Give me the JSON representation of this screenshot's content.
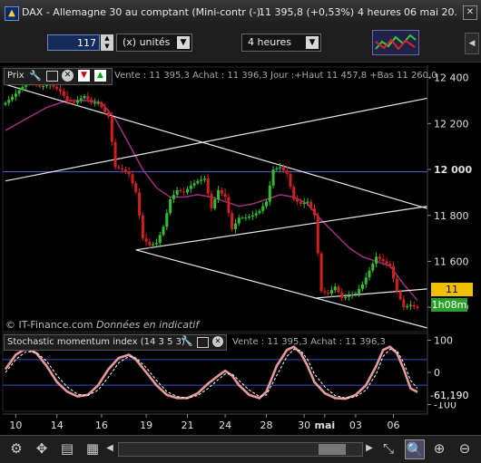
{
  "window": {
    "title": "DAX - Allemagne 30 au comptant (Mini-contr (-)",
    "last": "11 395,8 (+0,53%)",
    "period": "4 heures",
    "date": "06 mai 20..."
  },
  "toolbar": {
    "quantity": "117",
    "unit_label": "(x) unités",
    "timeframe": "4 heures"
  },
  "price_panel": {
    "label": "Prix",
    "info": "Vente : 11 395,3 Achat : 11 396,3 Jour :+Haut 11 457,8 +Bas 11 260,0",
    "watermark_brand": "© IT-Finance.com",
    "watermark_note": "Données en indicatif",
    "last_price_badge": "11 395,8",
    "time_left_badge": "1h08m"
  },
  "stoch_panel": {
    "label": "Stochastic momentum index (14 3 5 3)",
    "info": "Vente : 11 395,3 Achat : 11 396,3",
    "value_badge": "-61,190"
  },
  "colors": {
    "up": "#2fbf2f",
    "down": "#d12020",
    "ma": "#a0307f",
    "trendline": "#e8e8e8",
    "hline": "#4a6ad8",
    "stoch_main": "#e69a9a",
    "stoch_signal": "#ffffff",
    "stoch_level": "#3a50c8"
  },
  "chart_data": [
    {
      "type": "candlestick",
      "title": "DAX - Allemagne 30 au comptant (Mini-contr (-)",
      "y_ticks": [
        "12 400",
        "12 200",
        "12 000",
        "11 800",
        "11 600",
        "11 400"
      ],
      "ylim": [
        11310,
        12430
      ],
      "x_ticks": [
        "10",
        "14",
        "16",
        "19",
        "21",
        "24",
        "28",
        "30",
        "mai",
        "03",
        "06"
      ],
      "horizontal_line": 11990,
      "last_price": 11395.8,
      "close_path": [
        [
          0,
          12290
        ],
        [
          3,
          12330
        ],
        [
          7,
          12390
        ],
        [
          10,
          12360
        ],
        [
          13,
          12370
        ],
        [
          16,
          12340
        ],
        [
          18,
          12300
        ],
        [
          20,
          12290
        ],
        [
          23,
          12320
        ],
        [
          25,
          12290
        ],
        [
          27,
          12290
        ],
        [
          30,
          12230
        ],
        [
          32,
          12010
        ],
        [
          34,
          12000
        ],
        [
          36,
          11980
        ],
        [
          38,
          11900
        ],
        [
          40,
          11700
        ],
        [
          42,
          11670
        ],
        [
          44,
          11680
        ],
        [
          46,
          11750
        ],
        [
          48,
          11870
        ],
        [
          50,
          11910
        ],
        [
          52,
          11900
        ],
        [
          54,
          11930
        ],
        [
          56,
          11950
        ],
        [
          58,
          11960
        ],
        [
          60,
          11830
        ],
        [
          62,
          11910
        ],
        [
          64,
          11880
        ],
        [
          66,
          11740
        ],
        [
          68,
          11790
        ],
        [
          70,
          11790
        ],
        [
          72,
          11800
        ],
        [
          74,
          11820
        ],
        [
          76,
          11860
        ],
        [
          78,
          12000
        ],
        [
          80,
          12010
        ],
        [
          82,
          11980
        ],
        [
          84,
          11870
        ],
        [
          86,
          11850
        ],
        [
          88,
          11860
        ],
        [
          90,
          11800
        ],
        [
          92,
          11470
        ],
        [
          94,
          11460
        ],
        [
          96,
          11490
        ],
        [
          98,
          11440
        ],
        [
          100,
          11450
        ],
        [
          102,
          11460
        ],
        [
          104,
          11500
        ],
        [
          106,
          11560
        ],
        [
          108,
          11620
        ],
        [
          110,
          11600
        ],
        [
          112,
          11580
        ],
        [
          114,
          11470
        ],
        [
          116,
          11400
        ],
        [
          118,
          11410
        ],
        [
          120,
          11395.8
        ]
      ],
      "ma_path": [
        [
          0,
          12170
        ],
        [
          6,
          12220
        ],
        [
          12,
          12270
        ],
        [
          18,
          12300
        ],
        [
          24,
          12300
        ],
        [
          28,
          12290
        ],
        [
          32,
          12220
        ],
        [
          36,
          12110
        ],
        [
          40,
          12000
        ],
        [
          44,
          11920
        ],
        [
          48,
          11880
        ],
        [
          52,
          11880
        ],
        [
          56,
          11890
        ],
        [
          60,
          11880
        ],
        [
          64,
          11860
        ],
        [
          68,
          11840
        ],
        [
          72,
          11850
        ],
        [
          76,
          11870
        ],
        [
          80,
          11890
        ],
        [
          84,
          11880
        ],
        [
          88,
          11850
        ],
        [
          92,
          11780
        ],
        [
          96,
          11720
        ],
        [
          100,
          11660
        ],
        [
          104,
          11620
        ],
        [
          108,
          11600
        ],
        [
          112,
          11580
        ],
        [
          116,
          11500
        ],
        [
          120,
          11430
        ]
      ],
      "trendlines": [
        [
          [
            0,
            12370
          ],
          [
            120,
            11830
          ]
        ],
        [
          [
            38,
            11650
          ],
          [
            120,
            11840
          ]
        ],
        [
          [
            0,
            11950
          ],
          [
            120,
            12310
          ]
        ],
        [
          [
            38,
            11650
          ],
          [
            120,
            11310
          ]
        ],
        [
          [
            90,
            11440
          ],
          [
            120,
            11480
          ]
        ]
      ]
    },
    {
      "type": "line",
      "title": "Stochastic momentum index (14 3 5 3)",
      "y_ticks": [
        "100",
        "0",
        "-100"
      ],
      "ylim": [
        -110,
        110
      ],
      "levels": [
        40,
        -40
      ],
      "last_value": -61.19,
      "series": [
        {
          "name": "SMI",
          "values": [
            [
              0,
              10
            ],
            [
              3,
              55
            ],
            [
              6,
              75
            ],
            [
              9,
              60
            ],
            [
              12,
              20
            ],
            [
              15,
              -30
            ],
            [
              18,
              -60
            ],
            [
              21,
              -75
            ],
            [
              24,
              -70
            ],
            [
              27,
              -40
            ],
            [
              30,
              10
            ],
            [
              33,
              45
            ],
            [
              36,
              55
            ],
            [
              38,
              40
            ],
            [
              41,
              0
            ],
            [
              44,
              -40
            ],
            [
              47,
              -70
            ],
            [
              50,
              -80
            ],
            [
              53,
              -80
            ],
            [
              56,
              -65
            ],
            [
              59,
              -35
            ],
            [
              62,
              -10
            ],
            [
              64,
              5
            ],
            [
              66,
              -10
            ],
            [
              68,
              -40
            ],
            [
              71,
              -70
            ],
            [
              74,
              -80
            ],
            [
              76,
              -60
            ],
            [
              79,
              20
            ],
            [
              82,
              70
            ],
            [
              84,
              80
            ],
            [
              86,
              60
            ],
            [
              88,
              20
            ],
            [
              90,
              -30
            ],
            [
              93,
              -65
            ],
            [
              96,
              -80
            ],
            [
              99,
              -82
            ],
            [
              102,
              -70
            ],
            [
              105,
              -40
            ],
            [
              108,
              20
            ],
            [
              110,
              70
            ],
            [
              112,
              80
            ],
            [
              114,
              60
            ],
            [
              116,
              10
            ],
            [
              118,
              -50
            ],
            [
              120,
              -61.19
            ]
          ]
        },
        {
          "name": "Signal",
          "values": [
            [
              0,
              0
            ],
            [
              3,
              40
            ],
            [
              6,
              65
            ],
            [
              9,
              62
            ],
            [
              12,
              35
            ],
            [
              15,
              -10
            ],
            [
              18,
              -45
            ],
            [
              21,
              -68
            ],
            [
              24,
              -72
            ],
            [
              27,
              -55
            ],
            [
              30,
              -15
            ],
            [
              33,
              30
            ],
            [
              36,
              50
            ],
            [
              38,
              45
            ],
            [
              41,
              15
            ],
            [
              44,
              -25
            ],
            [
              47,
              -60
            ],
            [
              50,
              -75
            ],
            [
              53,
              -80
            ],
            [
              56,
              -72
            ],
            [
              59,
              -50
            ],
            [
              62,
              -22
            ],
            [
              64,
              -5
            ],
            [
              66,
              -5
            ],
            [
              68,
              -25
            ],
            [
              71,
              -55
            ],
            [
              74,
              -75
            ],
            [
              76,
              -70
            ],
            [
              79,
              -10
            ],
            [
              82,
              50
            ],
            [
              84,
              72
            ],
            [
              86,
              68
            ],
            [
              88,
              40
            ],
            [
              90,
              -5
            ],
            [
              93,
              -45
            ],
            [
              96,
              -72
            ],
            [
              99,
              -80
            ],
            [
              102,
              -76
            ],
            [
              105,
              -55
            ],
            [
              108,
              -5
            ],
            [
              110,
              50
            ],
            [
              112,
              72
            ],
            [
              114,
              68
            ],
            [
              116,
              30
            ],
            [
              118,
              -25
            ],
            [
              120,
              -50
            ]
          ]
        }
      ]
    }
  ]
}
